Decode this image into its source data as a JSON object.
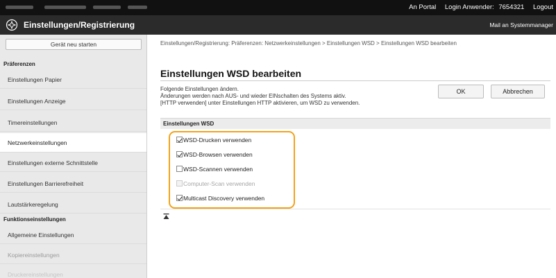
{
  "topbar": {
    "portal": "An Portal",
    "login_label": "Login Anwender:",
    "user_id": "7654321",
    "logout": "Logout"
  },
  "header": {
    "title": "Einstellungen/Registrierung",
    "mail": "Mail an Systemmanager"
  },
  "sidebar": {
    "start_button": "Gerät neu starten",
    "section_preferences": "Präferenzen",
    "items": [
      "Einstellungen Papier",
      "Einstellungen Anzeige",
      "Timereinstellungen",
      "Netzwerkeinstellungen",
      "Einstellungen externe Schnittstelle",
      "Einstellungen Barrierefreiheit",
      "Lautstärkeregelung"
    ],
    "section_functions": "Funktionseinstellungen",
    "func_items": [
      "Allgemeine Einstellungen",
      "Kopiereinstellungen",
      "Druckereinstellungen"
    ]
  },
  "main": {
    "breadcrumb": "Einstellungen/Registrierung: Präferenzen: Netzwerkeinstellungen > Einstellungen WSD > Einstellungen WSD bearbeiten",
    "title": "Einstellungen WSD bearbeiten",
    "description_1": "Folgende Einstellungen ändern.",
    "description_2": "Änderungen werden nach AUS- und wieder EINschalten des Systems aktiv.",
    "description_3": "[HTTP verwenden] unter Einstellungen HTTP aktivieren, um WSD zu verwenden.",
    "ok": "OK",
    "cancel": "Abbrechen",
    "panel_title": "Einstellungen WSD",
    "options": [
      {
        "label": "WSD-Drucken verwenden",
        "checked": true,
        "enabled": true
      },
      {
        "label": "WSD-Browsen verwenden",
        "checked": true,
        "enabled": true
      },
      {
        "label": "WSD-Scannen verwenden",
        "checked": false,
        "enabled": true
      },
      {
        "label": "Computer-Scan verwenden",
        "checked": false,
        "enabled": false
      },
      {
        "label": "Multicast Discovery verwenden",
        "checked": true,
        "enabled": true
      }
    ]
  },
  "colors": {
    "highlight": "#f2a219",
    "topbar": "#111111",
    "titlebar": "#2b2b2b"
  }
}
